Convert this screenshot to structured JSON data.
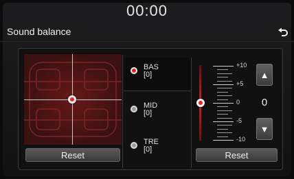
{
  "status_bar": {
    "time": "00:00"
  },
  "header": {
    "title": "Sound balance",
    "back_icon": "back-arrow-icon"
  },
  "balance_pad": {
    "reset_label": "Reset",
    "center_marker": "balance-knob"
  },
  "bands": [
    {
      "name": "BAS",
      "value": "[0]",
      "selected": true
    },
    {
      "name": "MID",
      "value": "[0]",
      "selected": false
    },
    {
      "name": "TRE",
      "value": "[0]",
      "selected": false
    }
  ],
  "level_editor": {
    "scale_labels": [
      "+10",
      "+5",
      "0",
      "-5",
      "-10"
    ],
    "current_value": "0",
    "level": 0,
    "up_icon": "triangle-up-icon",
    "down_icon": "triangle-down-icon",
    "reset_label": "Reset"
  },
  "colors": {
    "accent": "#e51d1d",
    "background": "#161617",
    "pad": "#3a1212"
  }
}
